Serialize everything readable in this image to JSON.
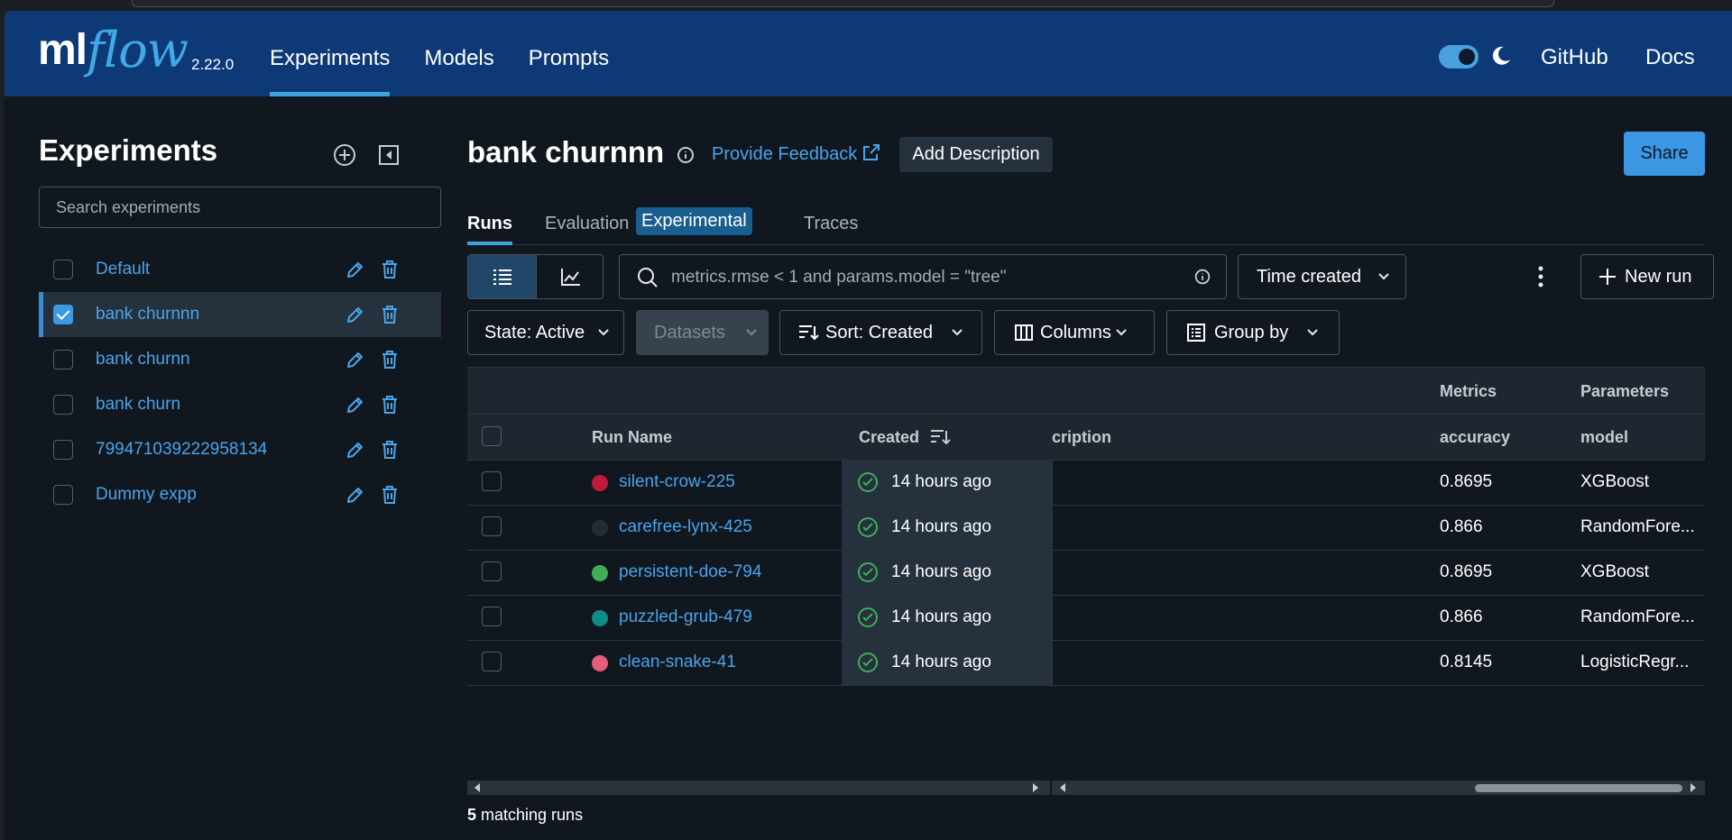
{
  "app": {
    "logo_ml": "ml",
    "logo_flow": "flow",
    "version": "2.22.0",
    "accent_color": "#3ea3dc",
    "header_color": "#0d3a77"
  },
  "nav": {
    "items": [
      {
        "label": "Experiments",
        "active": true
      },
      {
        "label": "Models",
        "active": false
      },
      {
        "label": "Prompts",
        "active": false
      }
    ],
    "github": "GitHub",
    "docs": "Docs",
    "theme_icon": "moon-icon"
  },
  "sidebar": {
    "title": "Experiments",
    "search_placeholder": "Search experiments",
    "experiments": [
      {
        "name": "Default",
        "checked": false
      },
      {
        "name": "bank churnnn",
        "checked": true
      },
      {
        "name": "bank churnn",
        "checked": false
      },
      {
        "name": "bank churn",
        "checked": false
      },
      {
        "name": "799471039222958134",
        "checked": false
      },
      {
        "name": "Dummy expp",
        "checked": false
      }
    ]
  },
  "main": {
    "title": "bank churnnn",
    "feedback_label": "Provide Feedback",
    "add_description_label": "Add Description",
    "share_label": "Share",
    "tabs": [
      {
        "label": "Runs",
        "active": true
      },
      {
        "label": "Evaluation",
        "active": false
      },
      {
        "label": "Traces",
        "active": false
      }
    ],
    "experimental_badge": "Experimental",
    "search_placeholder": "metrics.rmse < 1 and params.model = \"tree\"",
    "time_filter": "Time created",
    "new_run_label": "New run",
    "state_filter": "State: Active",
    "datasets_label": "Datasets",
    "sort_label": "Sort: Created",
    "columns_label": "Columns",
    "group_by_label": "Group by"
  },
  "table": {
    "group_headers": {
      "metrics": "Metrics",
      "parameters": "Parameters"
    },
    "columns": {
      "run_name": "Run Name",
      "created": "Created",
      "description": "cription",
      "accuracy": "accuracy",
      "model": "model"
    },
    "rows": [
      {
        "run_name": "silent-crow-225",
        "color": "#c2183b",
        "created": "14 hours ago",
        "accuracy": "0.8695",
        "model": "XGBoost"
      },
      {
        "run_name": "carefree-lynx-425",
        "color": "#252b33",
        "created": "14 hours ago",
        "accuracy": "0.866",
        "model": "RandomFore..."
      },
      {
        "run_name": "persistent-doe-794",
        "color": "#3fae59",
        "created": "14 hours ago",
        "accuracy": "0.8695",
        "model": "XGBoost"
      },
      {
        "run_name": "puzzled-grub-479",
        "color": "#0e8c86",
        "created": "14 hours ago",
        "accuracy": "0.866",
        "model": "RandomFore..."
      },
      {
        "run_name": "clean-snake-41",
        "color": "#e35d7d",
        "created": "14 hours ago",
        "accuracy": "0.8145",
        "model": "LogisticRegr..."
      }
    ],
    "matching_count": "5",
    "matching_suffix": " matching runs"
  }
}
